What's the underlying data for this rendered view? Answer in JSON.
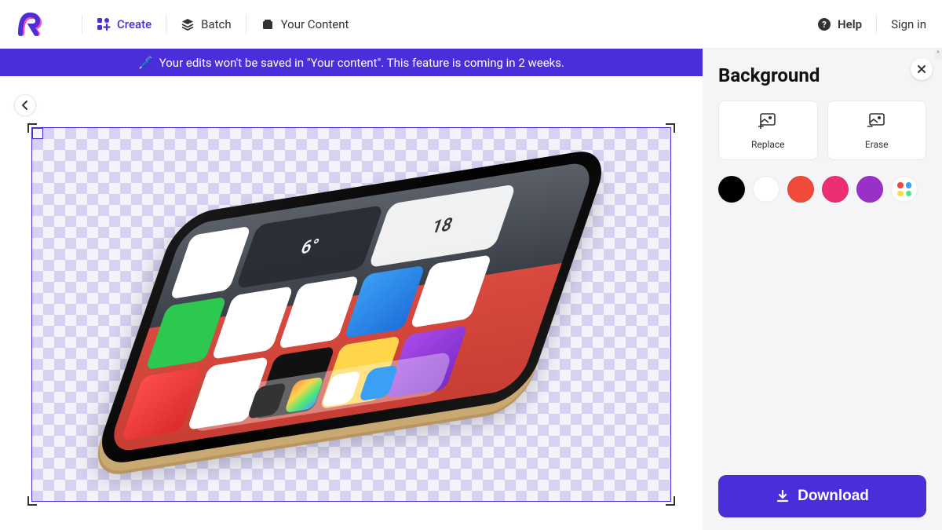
{
  "header": {
    "nav": {
      "create": "Create",
      "batch": "Batch",
      "your_content": "Your Content"
    },
    "help": "Help",
    "signin": "Sign in"
  },
  "banner": {
    "text": "Your edits won't be saved in \"Your content\". This feature is coming in 2 weeks."
  },
  "sidebar": {
    "title": "Background",
    "actions": {
      "replace": "Replace",
      "erase": "Erase"
    },
    "colors": {
      "black": "#000000",
      "white": "#ffffff",
      "red": "#f04a3a",
      "pink": "#ec2e74",
      "purple": "#9a30c8"
    },
    "download": "Download"
  },
  "phone": {
    "temp": "6°",
    "date_num": "18"
  },
  "brand": {
    "primary": "#4b2dda"
  }
}
